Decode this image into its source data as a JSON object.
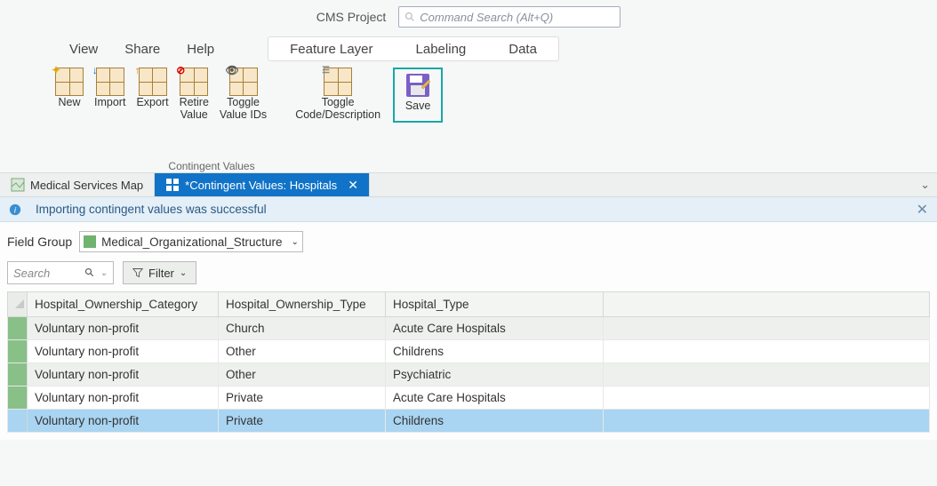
{
  "titlebar": {
    "project": "CMS Project",
    "search_placeholder": "Command Search (Alt+Q)"
  },
  "menu": {
    "view": "View",
    "share": "Share",
    "help": "Help"
  },
  "contextTabs": {
    "feature_layer": "Feature Layer",
    "labeling": "Labeling",
    "data": "Data"
  },
  "ribbon": {
    "new": "New",
    "import": "Import",
    "export": "Export",
    "retire": "Retire\nValue",
    "toggle_ids": "Toggle\nValue IDs",
    "toggle_code": "Toggle\nCode/Description",
    "save": "Save",
    "group_caption": "Contingent Values"
  },
  "docTabs": {
    "map": "Medical Services Map",
    "cv": "*Contingent Values: Hospitals"
  },
  "info": {
    "message": "Importing contingent values was successful"
  },
  "fieldGroup": {
    "label": "Field Group",
    "value": "Medical_Organizational_Structure"
  },
  "searchFilter": {
    "search_placeholder": "Search",
    "filter": "Filter"
  },
  "table": {
    "columns": [
      "Hospital_Ownership_Category",
      "Hospital_Ownership_Type",
      "Hospital_Type"
    ],
    "rows": [
      [
        "Voluntary non-profit",
        "Church",
        "Acute Care Hospitals"
      ],
      [
        "Voluntary non-profit",
        "Other",
        "Childrens"
      ],
      [
        "Voluntary non-profit",
        "Other",
        "Psychiatric"
      ],
      [
        "Voluntary non-profit",
        "Private",
        "Acute Care Hospitals"
      ],
      [
        "Voluntary non-profit",
        "Private",
        "Childrens"
      ]
    ],
    "selected_row": 4
  }
}
